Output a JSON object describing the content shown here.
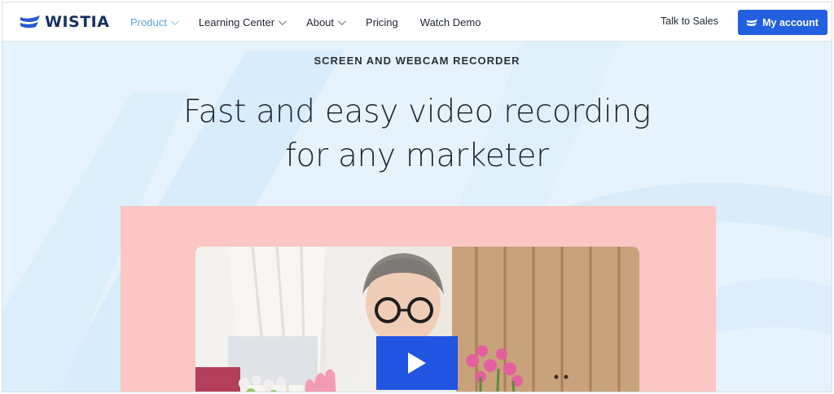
{
  "brand": {
    "name": "WISTIA",
    "color": "#1a2f66",
    "logo_icon": "wistia-flag-icon"
  },
  "nav": {
    "items": [
      {
        "label": "Product",
        "has_dropdown": true,
        "active": true
      },
      {
        "label": "Learning Center",
        "has_dropdown": true,
        "active": false
      },
      {
        "label": "About",
        "has_dropdown": true,
        "active": false
      },
      {
        "label": "Pricing",
        "has_dropdown": false,
        "active": false
      },
      {
        "label": "Watch Demo",
        "has_dropdown": false,
        "active": false
      }
    ],
    "talk_to_sales": "Talk to Sales",
    "account_button": "My account",
    "accent_color": "#2260e0",
    "active_color": "#56a6de"
  },
  "hero": {
    "eyebrow": "SCREEN AND WEBCAM RECORDER",
    "headline_line1": "Fast and easy video recording",
    "headline_line2": "for any marketer",
    "background_color": "#e6f3fc",
    "card_color": "#fbc6c4",
    "play_button_color": "#2154e0",
    "play_icon": "play-icon"
  }
}
